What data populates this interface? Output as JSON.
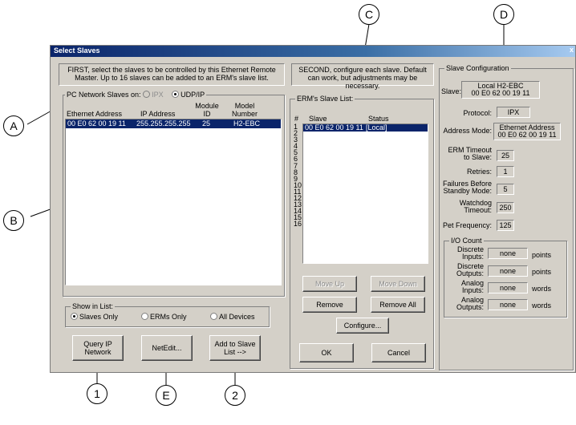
{
  "window": {
    "title": "Select Slaves",
    "close": "x"
  },
  "left": {
    "instructions": "FIRST, select the slaves to be controlled by this Ethernet Remote Master.  Up to 16 slaves can be added to an ERM's slave list.",
    "group_label": "PC Network Slaves on:",
    "radio_ipx": "IPX",
    "radio_udp": "UDP/IP",
    "columns": [
      "Ethernet Address",
      "IP Address",
      "Module ID",
      "Model Number"
    ],
    "rows": [
      {
        "eth": "00 E0 62 00 19 11",
        "ip": "255.255.255.255",
        "module": "25",
        "model": "H2-EBC"
      }
    ],
    "show_label": "Show in List:",
    "show_options": [
      "Slaves Only",
      "ERMs Only",
      "All Devices"
    ],
    "buttons": {
      "query": "Query IP Network",
      "netedit": "NetEdit...",
      "add": "Add to Slave List -->"
    }
  },
  "middle": {
    "instructions": "SECOND, configure each slave.  Default can work, but adjustments may be necessary.",
    "group_label": "ERM's Slave List:",
    "columns": [
      "#",
      "Slave",
      "Status"
    ],
    "rows": [
      {
        "n": "1",
        "slave": "00 E0 62 00 19 11",
        "status": "[Local]"
      },
      {
        "n": "2",
        "slave": "",
        "status": ""
      },
      {
        "n": "3",
        "slave": "",
        "status": ""
      },
      {
        "n": "4",
        "slave": "",
        "status": ""
      },
      {
        "n": "5",
        "slave": "",
        "status": ""
      },
      {
        "n": "6",
        "slave": "",
        "status": ""
      },
      {
        "n": "7",
        "slave": "",
        "status": ""
      },
      {
        "n": "8",
        "slave": "",
        "status": ""
      },
      {
        "n": "9",
        "slave": "",
        "status": ""
      },
      {
        "n": "10",
        "slave": "",
        "status": ""
      },
      {
        "n": "11",
        "slave": "",
        "status": ""
      },
      {
        "n": "12",
        "slave": "",
        "status": ""
      },
      {
        "n": "13",
        "slave": "",
        "status": ""
      },
      {
        "n": "14",
        "slave": "",
        "status": ""
      },
      {
        "n": "15",
        "slave": "",
        "status": ""
      },
      {
        "n": "16",
        "slave": "",
        "status": ""
      }
    ],
    "buttons": {
      "move_up": "Move Up",
      "move_down": "Move Down",
      "remove": "Remove",
      "remove_all": "Remove All",
      "configure": "Configure...",
      "ok": "OK",
      "cancel": "Cancel"
    }
  },
  "right": {
    "group_label": "Slave Configuration",
    "slave_label": "Slave:",
    "slave_value_line1": "Local  H2-EBC",
    "slave_value_line2": "00 E0 62 00 19 11",
    "protocol_label": "Protocol:",
    "protocol_value": "IPX",
    "address_mode_label": "Address Mode:",
    "address_mode_line1": "Ethernet Address",
    "address_mode_line2": "00 E0 62 00 19 11",
    "erm_timeout_label": "ERM Timeout to Slave:",
    "erm_timeout_value": "25",
    "retries_label": "Retries:",
    "retries_value": "1",
    "failures_label": "Failures Before Standby Mode:",
    "failures_value": "5",
    "watchdog_label": "Watchdog Timeout:",
    "watchdog_value": "250",
    "pet_label": "Pet Frequency:",
    "pet_value": "125",
    "io_group_label": "I/O Count",
    "io": [
      {
        "label": "Discrete Inputs:",
        "value": "none",
        "unit": "points"
      },
      {
        "label": "Discrete Outputs:",
        "value": "none",
        "unit": "points"
      },
      {
        "label": "Analog Inputs:",
        "value": "none",
        "unit": "words"
      },
      {
        "label": "Analog Outputs:",
        "value": "none",
        "unit": "words"
      }
    ]
  },
  "callouts": {
    "A": "A",
    "B": "B",
    "C": "C",
    "D": "D",
    "E": "E",
    "one": "1",
    "two": "2"
  }
}
